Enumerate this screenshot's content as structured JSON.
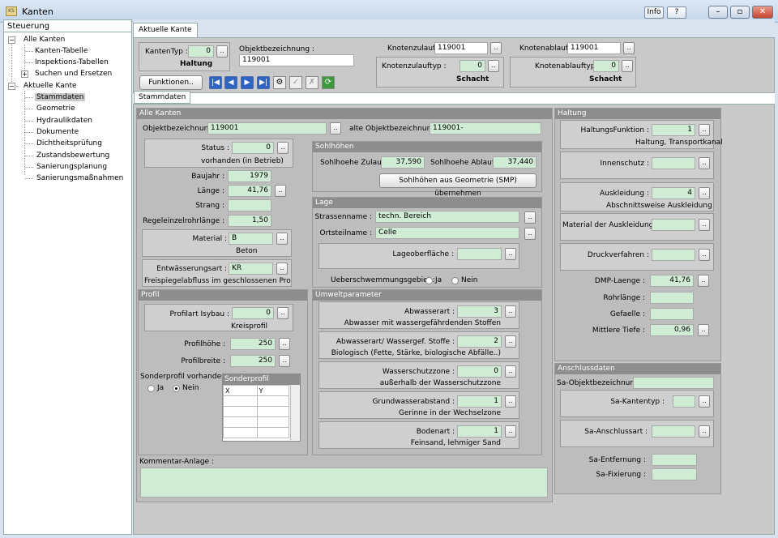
{
  "window": {
    "title": "Kanten",
    "icon_text": "KS",
    "info_label": "Info",
    "help_label": "?"
  },
  "sidebar": {
    "header": "Steuerung",
    "root1": "Alle Kanten",
    "root1_items": [
      "Kanten-Tabelle",
      "Inspektions-Tabellen",
      "Suchen und Ersetzen"
    ],
    "root2": "Aktuelle Kante",
    "root2_items": [
      "Stammdaten",
      "Geometrie",
      "Hydraulikdaten",
      "Dokumente",
      "Dichtheitsprüfung",
      "Zustandsbewertung",
      "Sanierungsplanung",
      "Sanierungsmaßnahmen"
    ],
    "selected": "Stammdaten"
  },
  "top": {
    "tab": "Aktuelle Kante",
    "kantentyp_label": "KantenTyp :",
    "kantentyp_value": "0",
    "kantentyp_text": "Haltung",
    "objekt_label": "Objektbezeichnung :",
    "objekt_value": "119001",
    "zulauf_label": "Knotenzulauf :",
    "zulauf_value": "119001",
    "zulauftyp_label": "Knotenzulauftyp :",
    "zulauftyp_value": "0",
    "zulauftyp_text": "Schacht",
    "ablauf_label": "Knotenablauf :",
    "ablauf_value": "119001",
    "ablauftyp_label": "Knotenablauftyp :",
    "ablauftyp_value": "0",
    "ablauftyp_text": "Schacht",
    "funktionen_label": "Funktionen.."
  },
  "subtab": "Stammdaten",
  "alle_kanten": {
    "header": "Alle Kanten",
    "objekt_label": "Objektbezeichnung :",
    "objekt_value": "119001",
    "alte_label": "alte Objektbezeichnung :",
    "alte_value": "119001-",
    "status_label": "Status :",
    "status_value": "0",
    "status_text": "vorhanden (in Betrieb)",
    "baujahr_label": "Baujahr :",
    "baujahr_value": "1979",
    "laenge_label": "Länge :",
    "laenge_value": "41,76",
    "strang_label": "Strang :",
    "strang_value": "",
    "regel_label": "Regeleinzelrohrlänge :",
    "regel_value": "1,50",
    "material_label": "Material :",
    "material_value": "B",
    "material_text": "Beton",
    "entw_label": "Entwässerungsart :",
    "entw_value": "KR",
    "entw_text": "Freispiegelabfluss im geschlossenen Profil, Reg",
    "kommentar_label": "Kommentar-Anlage :"
  },
  "sohlhoehen": {
    "header": "Sohlhöhen",
    "zulauf_label": "Sohlhoehe Zulauf :",
    "zulauf_value": "37,590",
    "ablauf_label": "Sohlhoehe Ablauf :",
    "ablauf_value": "37,440",
    "button": "Sohlhöhen aus Geometrie (SMP) übernehmen"
  },
  "lage": {
    "header": "Lage",
    "strasse_label": "Strassenname :",
    "strasse_value": "techn. Bereich",
    "ortsteil_label": "Ortsteilname :",
    "ortsteil_value": "Celle",
    "lageober_label": "Lageoberfläche :",
    "lageober_value": "",
    "ueber_label": "Ueberschwemmungsgebiet :",
    "ja": "Ja",
    "nein": "Nein"
  },
  "profil": {
    "header": "Profil",
    "art_label": "Profilart Isybau :",
    "art_value": "0",
    "art_text": "Kreisprofil",
    "hoehe_label": "Profilhöhe :",
    "hoehe_value": "250",
    "breite_label": "Profilbreite :",
    "breite_value": "250",
    "sonder_label": "Sonderprofil vorhanden :",
    "ja": "Ja",
    "nein": "Nein",
    "grid_title": "Sonderprofil",
    "grid_cols": [
      "X",
      "Y"
    ]
  },
  "umwelt": {
    "header": "Umweltparameter",
    "rows": [
      {
        "label": "Abwasserart :",
        "value": "3",
        "text": "Abwasser mit wassergefährdenden Stoffen"
      },
      {
        "label": "Abwasserart/ Wassergef. Stoffe :",
        "value": "2",
        "text": "Biologisch (Fette, Stärke, biologische Abfälle..)"
      },
      {
        "label": "Wasserschutzzone :",
        "value": "0",
        "text": "außerhalb der Wasserschutzzone"
      },
      {
        "label": "Grundwasserabstand :",
        "value": "1",
        "text": "Gerinne in der Wechselzone"
      },
      {
        "label": "Bodenart :",
        "value": "1",
        "text": "Feinsand, lehmiger Sand"
      }
    ]
  },
  "haltung": {
    "header": "Haltung",
    "funktion_label": "HaltungsFunktion :",
    "funktion_value": "1",
    "funktion_text": "Haltung, Transportkanal",
    "innen_label": "Innenschutz :",
    "innen_value": "",
    "ausk_label": "Auskleidung :",
    "ausk_value": "4",
    "ausk_text": "Abschnittsweise Auskleidung",
    "mat_label": "Material der Auskleidung :",
    "mat_value": "",
    "druck_label": "Druckverfahren :",
    "druck_value": "",
    "dmp_label": "DMP-Laenge :",
    "dmp_value": "41,76",
    "rohr_label": "Rohrlänge :",
    "rohr_value": "",
    "gef_label": "Gefaelle :",
    "gef_value": "",
    "tiefe_label": "Mittlere Tiefe :",
    "tiefe_value": "0,96"
  },
  "anschluss": {
    "header": "Anschlussdaten",
    "objekt_label": "Sa-Objektbezeichnung :",
    "objekt_value": "",
    "typ_label": "Sa-Kantentyp :",
    "typ_value": "",
    "art_label": "Sa-Anschlussart :",
    "art_value": "",
    "entf_label": "Sa-Entfernung :",
    "entf_value": "",
    "fix_label": "Sa-Fixierung :",
    "fix_value": ""
  }
}
